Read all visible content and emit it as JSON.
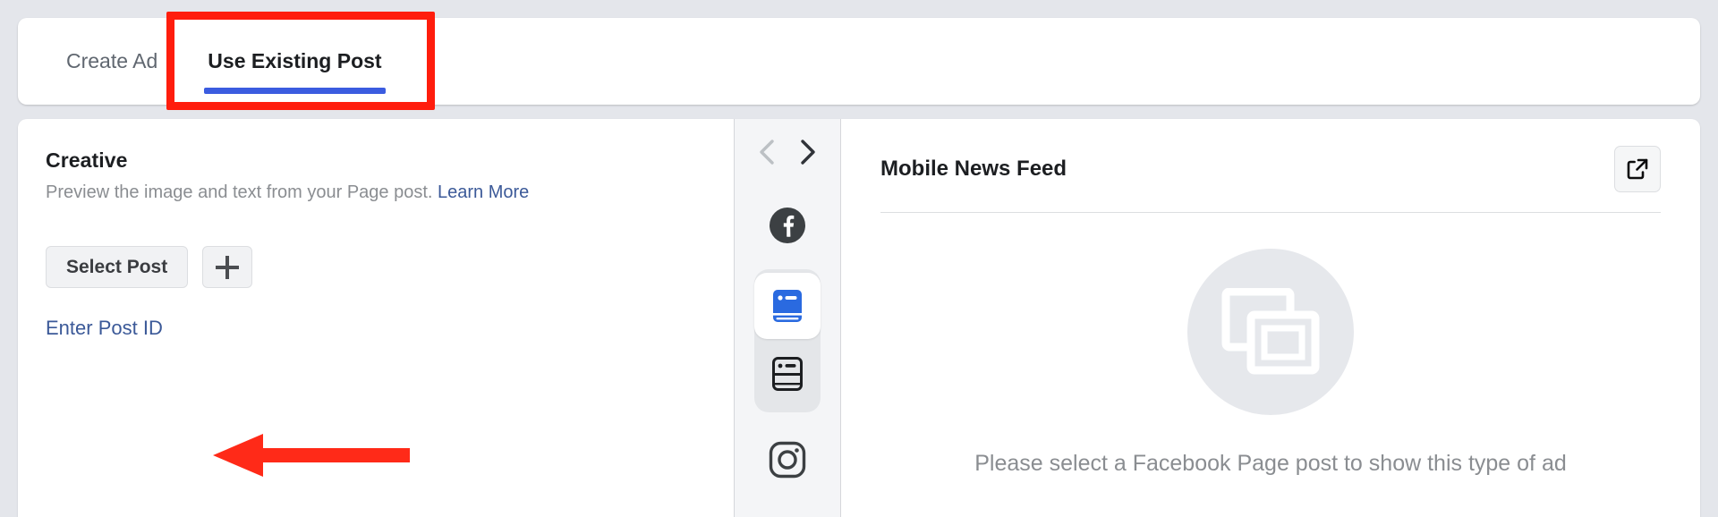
{
  "tabs": [
    {
      "label": "Create Ad",
      "active": false,
      "name": "tab-create-ad"
    },
    {
      "label": "Use Existing Post",
      "active": true,
      "name": "tab-use-existing-post"
    }
  ],
  "creative": {
    "title": "Creative",
    "description": "Preview the image and text from your Page post.",
    "learn_more": "Learn More",
    "select_post_button": "Select Post",
    "add_button_icon": "plus-icon",
    "enter_post_id_link": "Enter Post ID"
  },
  "rail": {
    "prev_icon": "chevron-left-icon",
    "next_icon": "chevron-right-icon",
    "platforms": [
      {
        "name": "facebook-logo-icon",
        "selected": false
      },
      {
        "name": "mobile-news-feed-icon",
        "selected": true
      },
      {
        "name": "desktop-news-feed-icon",
        "selected": false
      },
      {
        "name": "instagram-logo-icon",
        "selected": false
      }
    ]
  },
  "preview": {
    "title": "Mobile News Feed",
    "popout_icon": "open-in-new-window-icon",
    "placeholder_icon": "images-placeholder-icon",
    "empty_message": "Please select a Facebook Page post to show this type of ad"
  },
  "annotations": {
    "highlight_box_color": "#ff1d0d",
    "arrow_color": "#ff2a18",
    "arrow_points_to": "Enter Post ID",
    "highlight_target": "Use Existing Post"
  },
  "colors": {
    "accent_blue": "#3b5ce0",
    "link_blue": "#3b5998",
    "page_background": "#e4e6eb",
    "card_background": "#ffffff",
    "rail_background": "#f4f5f7"
  }
}
